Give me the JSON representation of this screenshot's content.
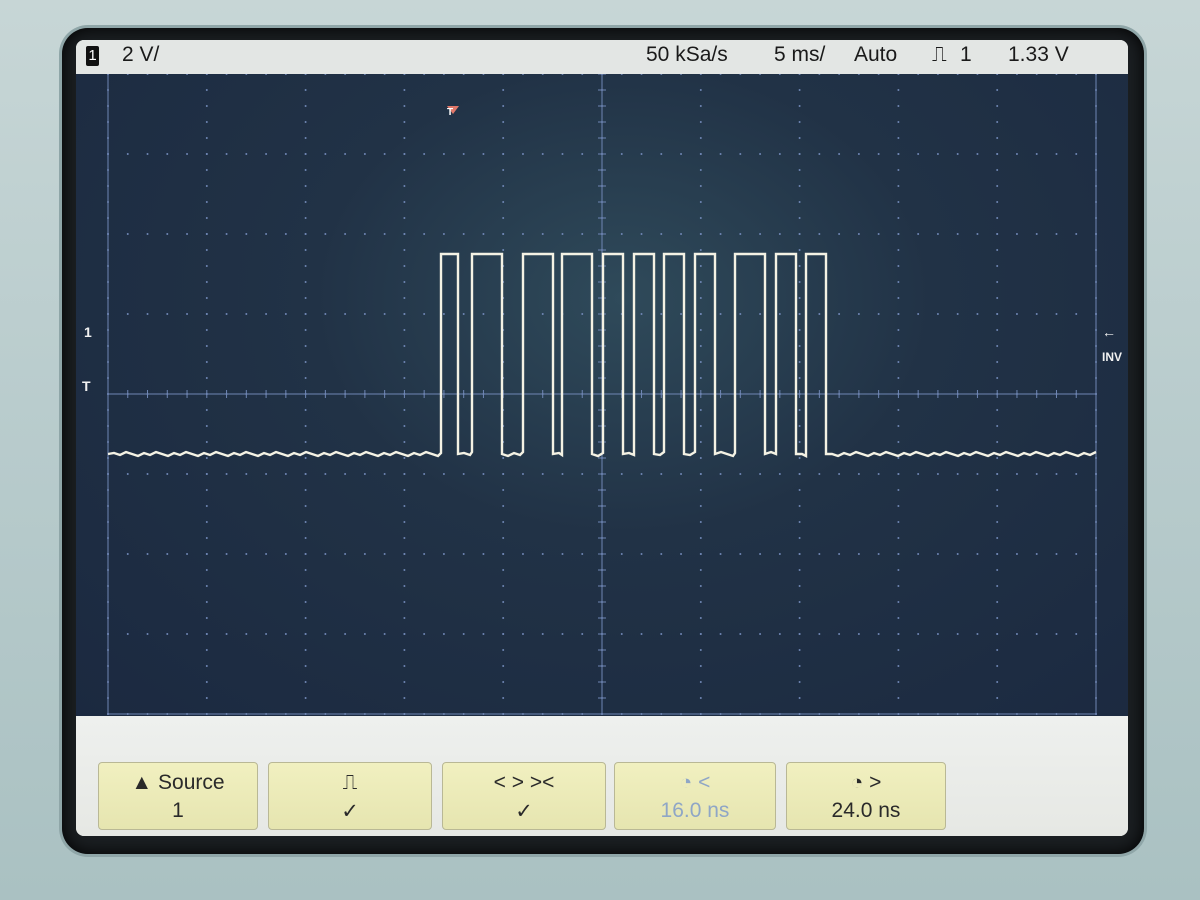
{
  "status_bar": {
    "channel": "1",
    "scale": "2 V/",
    "sample_rate": "50 kSa/s",
    "timebase": "5 ms/",
    "trigger_mode": "Auto",
    "trigger_symbol": "⎍",
    "trigger_source": "1",
    "trigger_level": "1.33 V"
  },
  "markers": {
    "trigger_position": "T",
    "channel_ground": "1",
    "trigger_level_left": "T",
    "trigger_level_right": "←",
    "inv_label": "INV"
  },
  "softkeys": [
    {
      "top": "▲ Source",
      "bottom": "1"
    },
    {
      "top": "⎍",
      "bottom": "✓"
    },
    {
      "top": "< > ><",
      "bottom": "✓"
    },
    {
      "top": "◔ <",
      "bottom": "16.0 ns"
    },
    {
      "top": "◔ >",
      "bottom": "24.0 ns"
    }
  ],
  "colors": {
    "trace": "#f4f2e4",
    "grid": "#6f86b4",
    "softkey": "#eceab8"
  }
}
